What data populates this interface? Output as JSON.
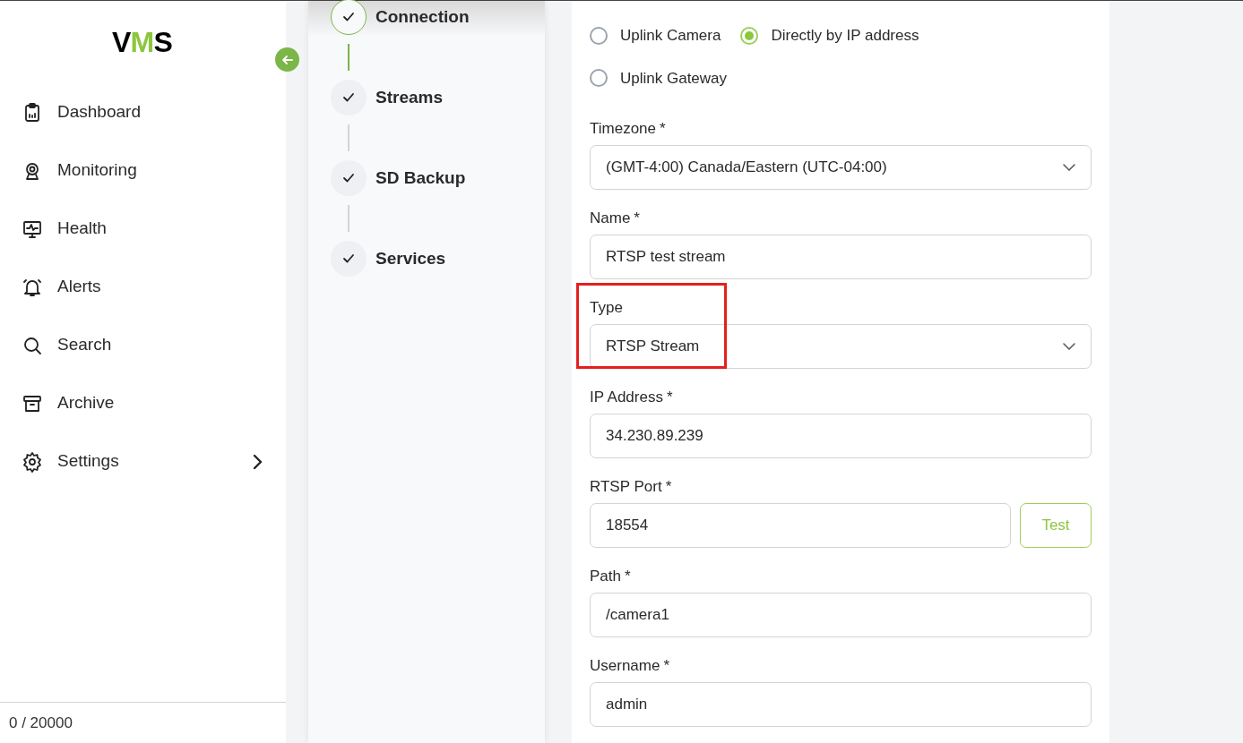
{
  "sidebar": {
    "logo": {
      "parts": [
        {
          "text": "V",
          "accent": false
        },
        {
          "text": "M",
          "accent": true
        },
        {
          "text": "S",
          "accent": false
        }
      ]
    },
    "items": [
      {
        "kind": "dashboard",
        "label": "Dashboard",
        "expandable": false
      },
      {
        "kind": "monitoring",
        "label": "Monitoring",
        "expandable": false
      },
      {
        "kind": "health",
        "label": "Health",
        "expandable": false
      },
      {
        "kind": "alerts",
        "label": "Alerts",
        "expandable": false
      },
      {
        "kind": "search",
        "label": "Search",
        "expandable": false
      },
      {
        "kind": "archive",
        "label": "Archive",
        "expandable": false
      },
      {
        "kind": "settings",
        "label": "Settings",
        "expandable": true
      }
    ],
    "credits": "0 / 20000"
  },
  "steps": [
    {
      "label": "Connection",
      "selected": true,
      "completed": true
    },
    {
      "label": "Streams",
      "selected": false,
      "completed": true
    },
    {
      "label": "SD Backup",
      "selected": false,
      "completed": true
    },
    {
      "label": "Services",
      "selected": false,
      "completed": true
    }
  ],
  "connection_options": [
    {
      "label": "Uplink Camera",
      "selected": false
    },
    {
      "label": "Directly by IP address",
      "selected": true
    },
    {
      "label": "Uplink Gateway",
      "selected": false
    }
  ],
  "fields": [
    {
      "kind": "select",
      "label": "Timezone",
      "required_mark": "*",
      "value": "(GMT-4:00) Canada/Eastern (UTC-04:00)",
      "highlighted": false
    },
    {
      "kind": "text",
      "label": "Name",
      "required_mark": "*",
      "value": "RTSP test stream",
      "highlighted": false
    },
    {
      "kind": "select",
      "label": "Type",
      "value": "RTSP Stream",
      "highlighted": true
    },
    {
      "kind": "text",
      "label": "IP Address",
      "required_mark": "*",
      "value": "34.230.89.239",
      "highlighted": false
    },
    {
      "kind": "text_button",
      "label": "RTSP Port",
      "required_mark": "*",
      "value": "18554",
      "button": "Test",
      "highlighted": false
    },
    {
      "kind": "text",
      "label": "Path",
      "required_mark": "*",
      "value": "/camera1",
      "highlighted": false
    },
    {
      "kind": "text",
      "label": "Username",
      "required_mark": "*",
      "value": "admin",
      "highlighted": false
    }
  ]
}
